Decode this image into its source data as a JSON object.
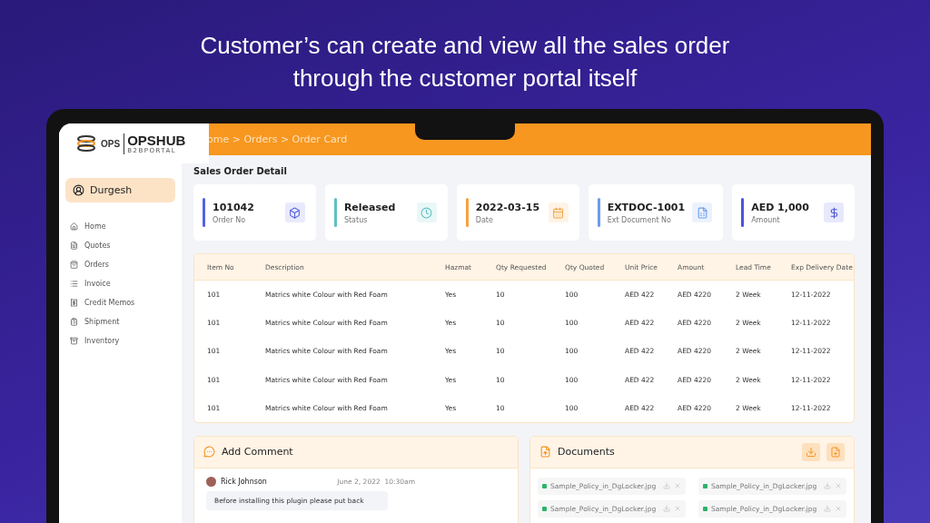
{
  "headline": [
    "Customer’s can create and view all the sales order",
    "through the customer portal itself"
  ],
  "logo": {
    "left": "OPS",
    "right": "OPSHUB",
    "sub": "B2BPORTAL"
  },
  "breadcrumb": "ome > Orders > Order Card",
  "sidebar": {
    "user": "Durgesh",
    "items": [
      {
        "label": "Home",
        "kind": "home"
      },
      {
        "label": "Quotes",
        "kind": "quote"
      },
      {
        "label": "Orders",
        "kind": "bag"
      },
      {
        "label": "Invoice",
        "kind": "list"
      },
      {
        "label": "Credit Memos",
        "kind": "memo"
      },
      {
        "label": "Shipment",
        "kind": "clipboard"
      },
      {
        "label": "Inventory",
        "kind": "archive"
      }
    ]
  },
  "page_title": "Sales Order Detail",
  "cards": [
    {
      "value": "101042",
      "label": "Order No",
      "kind": "box",
      "color": "#5563e0"
    },
    {
      "value": "Released",
      "label": "Status",
      "kind": "clock",
      "color": "#5fc0c4"
    },
    {
      "value": "2022-03-15",
      "label": "Date",
      "kind": "calendar",
      "color": "#f4a340"
    },
    {
      "value": "EXTDOC-1001",
      "label": "Ext Document No",
      "kind": "document",
      "color": "#6a9bf0"
    },
    {
      "value": "AED 1,000",
      "label": "Amount",
      "kind": "dollar",
      "color": "#4a55d8"
    }
  ],
  "table": {
    "columns": [
      "Item No",
      "Description",
      "Hazmat",
      "Qty Requested",
      "Qty Quoted",
      "Unit Price",
      "Amount",
      "Lead Time",
      "Exp Delivery Date"
    ],
    "rows": [
      [
        "101",
        "Matrics white Colour with Red Foam",
        "Yes",
        "10",
        "100",
        "AED 422",
        "AED 4220",
        "2 Week",
        "12-11-2022"
      ],
      [
        "101",
        "Matrics white Colour with Red Foam",
        "Yes",
        "10",
        "100",
        "AED 422",
        "AED 4220",
        "2 Week",
        "12-11-2022"
      ],
      [
        "101",
        "Matrics white Colour with Red Foam",
        "Yes",
        "10",
        "100",
        "AED 422",
        "AED 4220",
        "2 Week",
        "12-11-2022"
      ],
      [
        "101",
        "Matrics white Colour with Red Foam",
        "Yes",
        "10",
        "100",
        "AED 422",
        "AED 4220",
        "2 Week",
        "12-11-2022"
      ],
      [
        "101",
        "Matrics white Colour with Red Foam",
        "Yes",
        "10",
        "100",
        "AED 422",
        "AED 4220",
        "2 Week",
        "12-11-2022"
      ]
    ]
  },
  "comments": {
    "title": "Add Comment",
    "items": [
      {
        "author": "Rick Johnson",
        "time": "June 2, 2022  10:30am",
        "text": "Before installing this plugin please put back"
      }
    ]
  },
  "documents": {
    "title": "Documents",
    "files": [
      "Sample_Policy_in_DgLocker.jpg",
      "Sample_Policy_in_DgLocker.jpg",
      "Sample_Policy_in_DgLocker.jpg",
      "Sample_Policy_in_DgLocker.jpg"
    ]
  }
}
